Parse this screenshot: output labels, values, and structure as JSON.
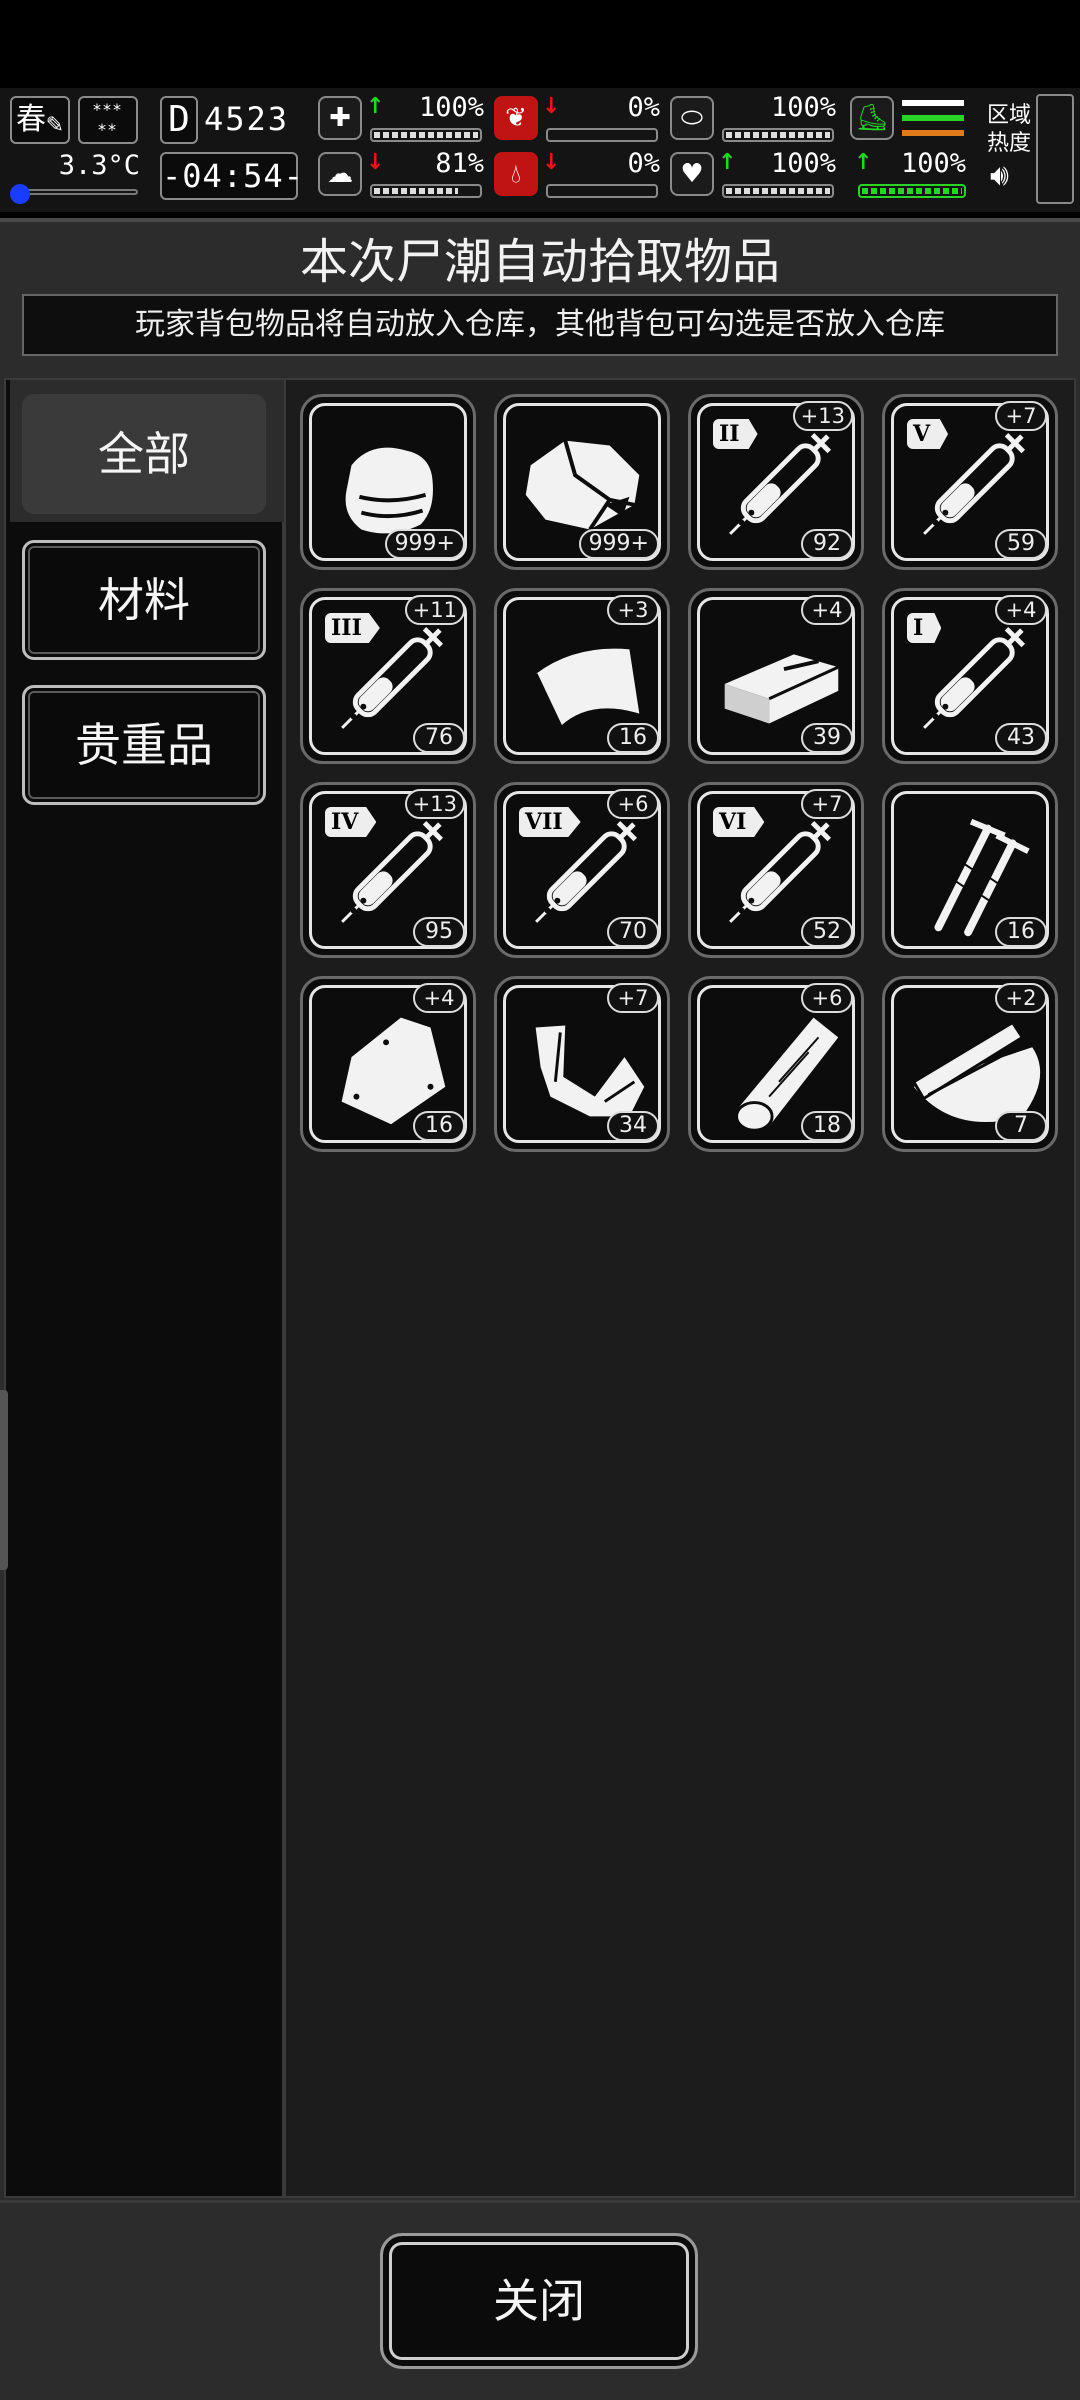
{
  "status": {
    "season": "春",
    "weather": "***\n**",
    "temperature": "3.3°C",
    "day_letter": "D",
    "day_number": "4523",
    "clock": "-04:54-",
    "stats_top": [
      {
        "name": "health",
        "arrow": "↑",
        "arrow_color": "#28d428",
        "value": "100%",
        "level": 1.0
      },
      {
        "name": "hunger",
        "arrow": "↓",
        "arrow_color": "#e8141a",
        "value": "0%",
        "level": 0.0
      },
      {
        "name": "immunity",
        "arrow": "",
        "arrow_color": "",
        "value": "100%",
        "level": 1.0
      }
    ],
    "stats_bottom": [
      {
        "name": "sanity",
        "arrow": "↓",
        "arrow_color": "#e8141a",
        "value": "81%",
        "level": 0.81
      },
      {
        "name": "thirst",
        "arrow": "↓",
        "arrow_color": "#e8141a",
        "value": "0%",
        "level": 0.0
      },
      {
        "name": "heart",
        "arrow": "↑",
        "arrow_color": "#28d428",
        "value": "100%",
        "level": 1.0
      }
    ],
    "stamina": {
      "value": "100%",
      "arrow": "↑",
      "level": 1.0
    },
    "area_label_1": "区域",
    "area_label_2": "热度"
  },
  "panel": {
    "title": "本次尸潮自动拾取物品",
    "notice": "玩家背包物品将自动放入仓库，其他背包可勾选是否放入仓库"
  },
  "categories": [
    {
      "label": "全部",
      "active": true
    },
    {
      "label": "材料",
      "active": false
    },
    {
      "label": "贵重品",
      "active": false
    }
  ],
  "items": [
    {
      "icon": "cloth-icon",
      "count": "999+",
      "bonus": "",
      "tier": ""
    },
    {
      "icon": "ore-rock-icon",
      "count": "999+",
      "bonus": "",
      "tier": ""
    },
    {
      "icon": "syringe-icon",
      "count": "92",
      "bonus": "+13",
      "tier": "II"
    },
    {
      "icon": "syringe-icon",
      "count": "59",
      "bonus": "+7",
      "tier": "V"
    },
    {
      "icon": "syringe-icon",
      "count": "76",
      "bonus": "+11",
      "tier": "III"
    },
    {
      "icon": "leather-sheet-icon",
      "count": "16",
      "bonus": "+3",
      "tier": ""
    },
    {
      "icon": "brick-icon",
      "count": "39",
      "bonus": "+4",
      "tier": ""
    },
    {
      "icon": "syringe-icon",
      "count": "43",
      "bonus": "+4",
      "tier": "I"
    },
    {
      "icon": "syringe-icon",
      "count": "95",
      "bonus": "+13",
      "tier": "IV"
    },
    {
      "icon": "syringe-icon",
      "count": "70",
      "bonus": "+6",
      "tier": "VII"
    },
    {
      "icon": "syringe-icon",
      "count": "52",
      "bonus": "+7",
      "tier": "VI"
    },
    {
      "icon": "nails-icon",
      "count": "16",
      "bonus": "",
      "tier": ""
    },
    {
      "icon": "plastic-bag-icon",
      "count": "16",
      "bonus": "+4",
      "tier": ""
    },
    {
      "icon": "scrap-metal-icon",
      "count": "34",
      "bonus": "+7",
      "tier": ""
    },
    {
      "icon": "wood-log-icon",
      "count": "18",
      "bonus": "+6",
      "tier": ""
    },
    {
      "icon": "wood-planks-icon",
      "count": "7",
      "bonus": "+2",
      "tier": ""
    }
  ],
  "footer": {
    "close_label": "关闭"
  }
}
